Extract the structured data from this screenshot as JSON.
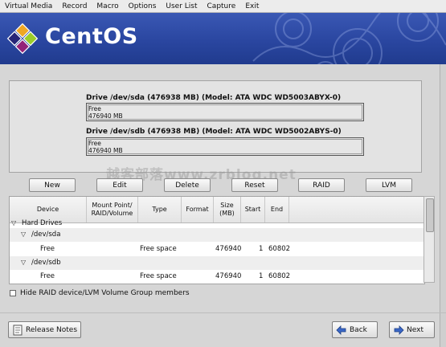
{
  "menu": [
    "Virtual Media",
    "Record",
    "Macro",
    "Options",
    "User List",
    "Capture",
    "Exit"
  ],
  "banner": {
    "brand": "CentOS"
  },
  "drives": [
    {
      "title": "Drive /dev/sda (476938 MB) (Model: ATA WDC WD5003ABYX-0)",
      "label": "Free",
      "size": "476940 MB"
    },
    {
      "title": "Drive /dev/sdb (476938 MB) (Model: ATA WDC WD5002ABYS-0)",
      "label": "Free",
      "size": "476940 MB"
    }
  ],
  "buttons": {
    "new": "New",
    "edit": "Edit",
    "delete": "Delete",
    "reset": "Reset",
    "raid": "RAID",
    "lvm": "LVM"
  },
  "table": {
    "headers": {
      "device": "Device",
      "mount": "Mount Point/ RAID/Volume",
      "type": "Type",
      "format": "Format",
      "size": "Size (MB)",
      "start": "Start",
      "end": "End"
    },
    "rows": [
      {
        "device": "Hard Drives",
        "type": "",
        "size": "",
        "start": "",
        "end": ""
      },
      {
        "device": "/dev/sda",
        "type": "",
        "size": "",
        "start": "",
        "end": ""
      },
      {
        "device": "Free",
        "type": "Free space",
        "size": "476940",
        "start": "1",
        "end": "60802"
      },
      {
        "device": "/dev/sdb",
        "type": "",
        "size": "",
        "start": "",
        "end": ""
      },
      {
        "device": "Free",
        "type": "Free space",
        "size": "476940",
        "start": "1",
        "end": "60802"
      }
    ]
  },
  "hide_checkbox_label": "Hide RAID device/LVM Volume Group members",
  "footer": {
    "release_notes": "Release Notes",
    "back": "Back",
    "next": "Next"
  },
  "watermark": "越客部落www.zrblog.net"
}
